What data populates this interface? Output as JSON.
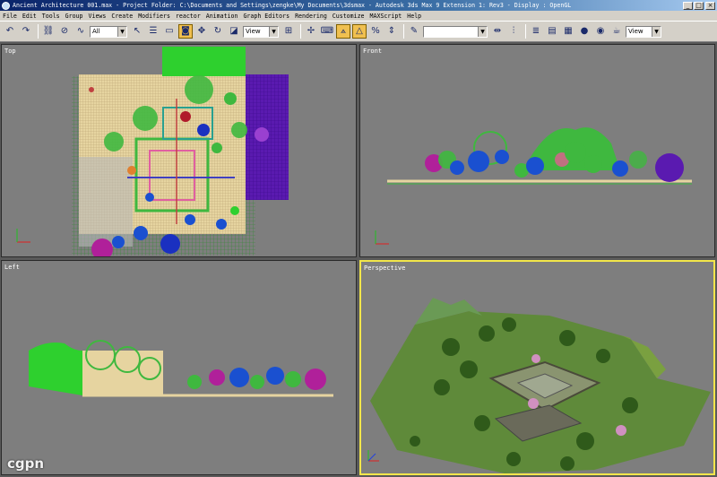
{
  "window": {
    "title": "Ancient Architecture 001.max    - Project Folder: C:\\Documents and Settings\\zengke\\My Documents\\3dsmax    - Autodesk 3ds Max 9 Extension 1: Rev3    - Display : OpenGL",
    "controls": {
      "minimize": "_",
      "maximize": "□",
      "close": "×"
    }
  },
  "menu": [
    "File",
    "Edit",
    "Tools",
    "Group",
    "Views",
    "Create",
    "Modifiers",
    "reactor",
    "Animation",
    "Graph Editors",
    "Rendering",
    "Customize",
    "MAXScript",
    "Help"
  ],
  "toolbar": {
    "selection_filter": "All",
    "ref_coord_system": "View",
    "named_selection": "",
    "view_dropdown": "View"
  },
  "viewports": {
    "top": {
      "label": "Top"
    },
    "front": {
      "label": "Front"
    },
    "left": {
      "label": "Left"
    },
    "perspective": {
      "label": "Perspective"
    }
  },
  "watermark": "cgpn",
  "colors": {
    "viewport_bg": "#7e7e7e",
    "active_border": "#f2e64a",
    "foliage_green": "#3fb83f",
    "building_purple": "#5a1ab0",
    "grass": "#6a8a40",
    "sand": "#e6d4a0"
  }
}
